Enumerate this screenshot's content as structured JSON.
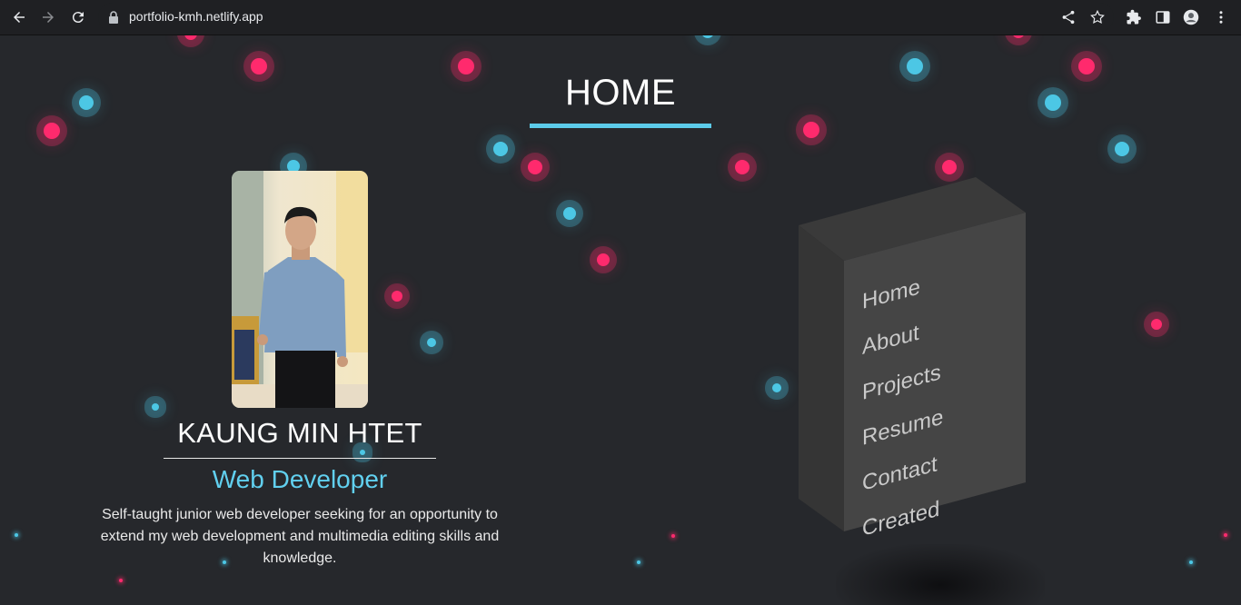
{
  "browser": {
    "url": "portfolio-kmh.netlify.app"
  },
  "page": {
    "title": "HOME",
    "accent_color": "#5ccbea",
    "orb_colors": {
      "pink": "#ff2a6d",
      "blue": "#4cc7e5"
    }
  },
  "profile": {
    "name": "KAUNG MIN HTET",
    "role": "Web Developer",
    "bio": "Self-taught junior web developer seeking for an opportunity to extend my web development and multimedia editing skills and knowledge."
  },
  "menu": {
    "items": [
      {
        "label": "Home"
      },
      {
        "label": "About"
      },
      {
        "label": "Projects"
      },
      {
        "label": "Resume"
      },
      {
        "label": "Contact"
      },
      {
        "label": "Created"
      }
    ]
  }
}
